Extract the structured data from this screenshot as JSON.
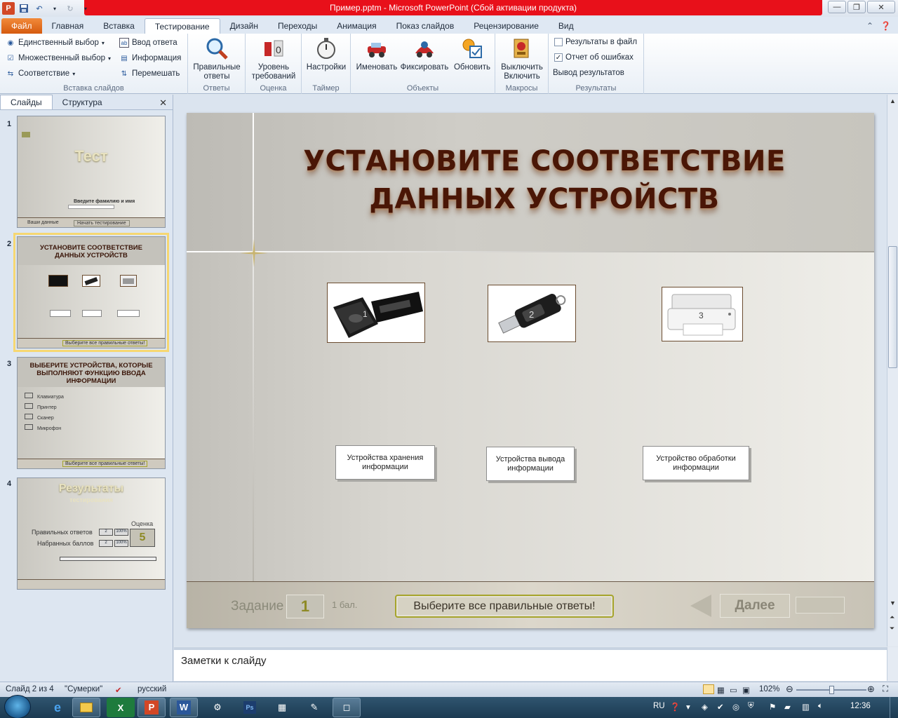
{
  "window": {
    "title": "Пример.pptm  -  Microsoft PowerPoint (Сбой активации продукта)",
    "app_letter": "P"
  },
  "ribbon_tabs": [
    "Файл",
    "Главная",
    "Вставка",
    "Тестирование",
    "Дизайн",
    "Переходы",
    "Анимация",
    "Показ слайдов",
    "Рецензирование",
    "Вид"
  ],
  "ribbon": {
    "insert_group": {
      "label": "Вставка слайдов",
      "single_choice": "Единственный выбор",
      "multiple_choice": "Множественный выбор",
      "matching": "Соответствие",
      "text_input": "Ввод ответа",
      "info": "Информация",
      "shuffle": "Перемешать"
    },
    "answers_group": {
      "label": "Ответы",
      "button": "Правильные ответы"
    },
    "grading_group": {
      "label": "Оценка",
      "button": "Уровень требований"
    },
    "timer_group": {
      "label": "Таймер",
      "button": "Настройки"
    },
    "objects_group": {
      "label": "Объекты",
      "rename": "Именовать",
      "fix": "Фиксировать",
      "refresh": "Обновить"
    },
    "macros_group": {
      "label": "Макросы",
      "button": "Выключить Включить"
    },
    "results_group": {
      "label": "Результаты",
      "to_file": "Результаты в файл",
      "to_file_checked": false,
      "error_report": "Отчет об ошибках",
      "error_report_checked": true,
      "output": "Вывод результатов"
    }
  },
  "pane": {
    "tabs": [
      "Слайды",
      "Структура"
    ],
    "slides": [
      {
        "num": "1",
        "title": "Тест",
        "line": "Введите фамилию и имя",
        "bar_left": "Ваши данные",
        "bar_mid": "Начать тестирование"
      },
      {
        "num": "2",
        "title": "УСТАНОВИТЕ СООТВЕТСТВИЕ ДАННЫХ УСТРОЙСТВ",
        "bar_mid": "Выберите все правильные ответы!"
      },
      {
        "num": "3",
        "title": "ВЫБЕРИТЕ УСТРОЙСТВА, КОТОРЫЕ ВЫПОЛНЯЮТ ФУНКЦИЮ ВВОДА ИНФОРМАЦИИ",
        "items": [
          "Клавиатура",
          "Принтер",
          "Сканер",
          "Микрофон"
        ],
        "bar_mid": "Выберите все правильные ответы!"
      },
      {
        "num": "4",
        "title": "Результаты",
        "subtitle": "тестирования",
        "grade_label": "Оценка",
        "grade": "5",
        "correct_label": "Правильных ответов",
        "points_label": "Набранных баллов",
        "val": "2",
        "pct": "100%"
      }
    ]
  },
  "slide": {
    "title_line1": "УСТАНОВИТЕ СООТВЕТСТВИЕ",
    "title_line2": "ДАННЫХ УСТРОЙСТВ",
    "device_numbers": [
      "1",
      "2",
      "3"
    ],
    "labels": [
      "Устройства  хранения информации",
      "Устройства вывода информации",
      "Устройство обработки информации"
    ],
    "task_label": "Задание",
    "task_number": "1",
    "score": "1 бал.",
    "hint": "Выберите все правильные  ответы!",
    "next": "Далее"
  },
  "notes": {
    "placeholder": "Заметки к слайду"
  },
  "status": {
    "slide_info": "Слайд 2 из 4",
    "theme": "\"Сумерки\"",
    "language": "русский",
    "zoom": "102%"
  },
  "taskbar": {
    "lang": "RU",
    "time": "12:36"
  }
}
